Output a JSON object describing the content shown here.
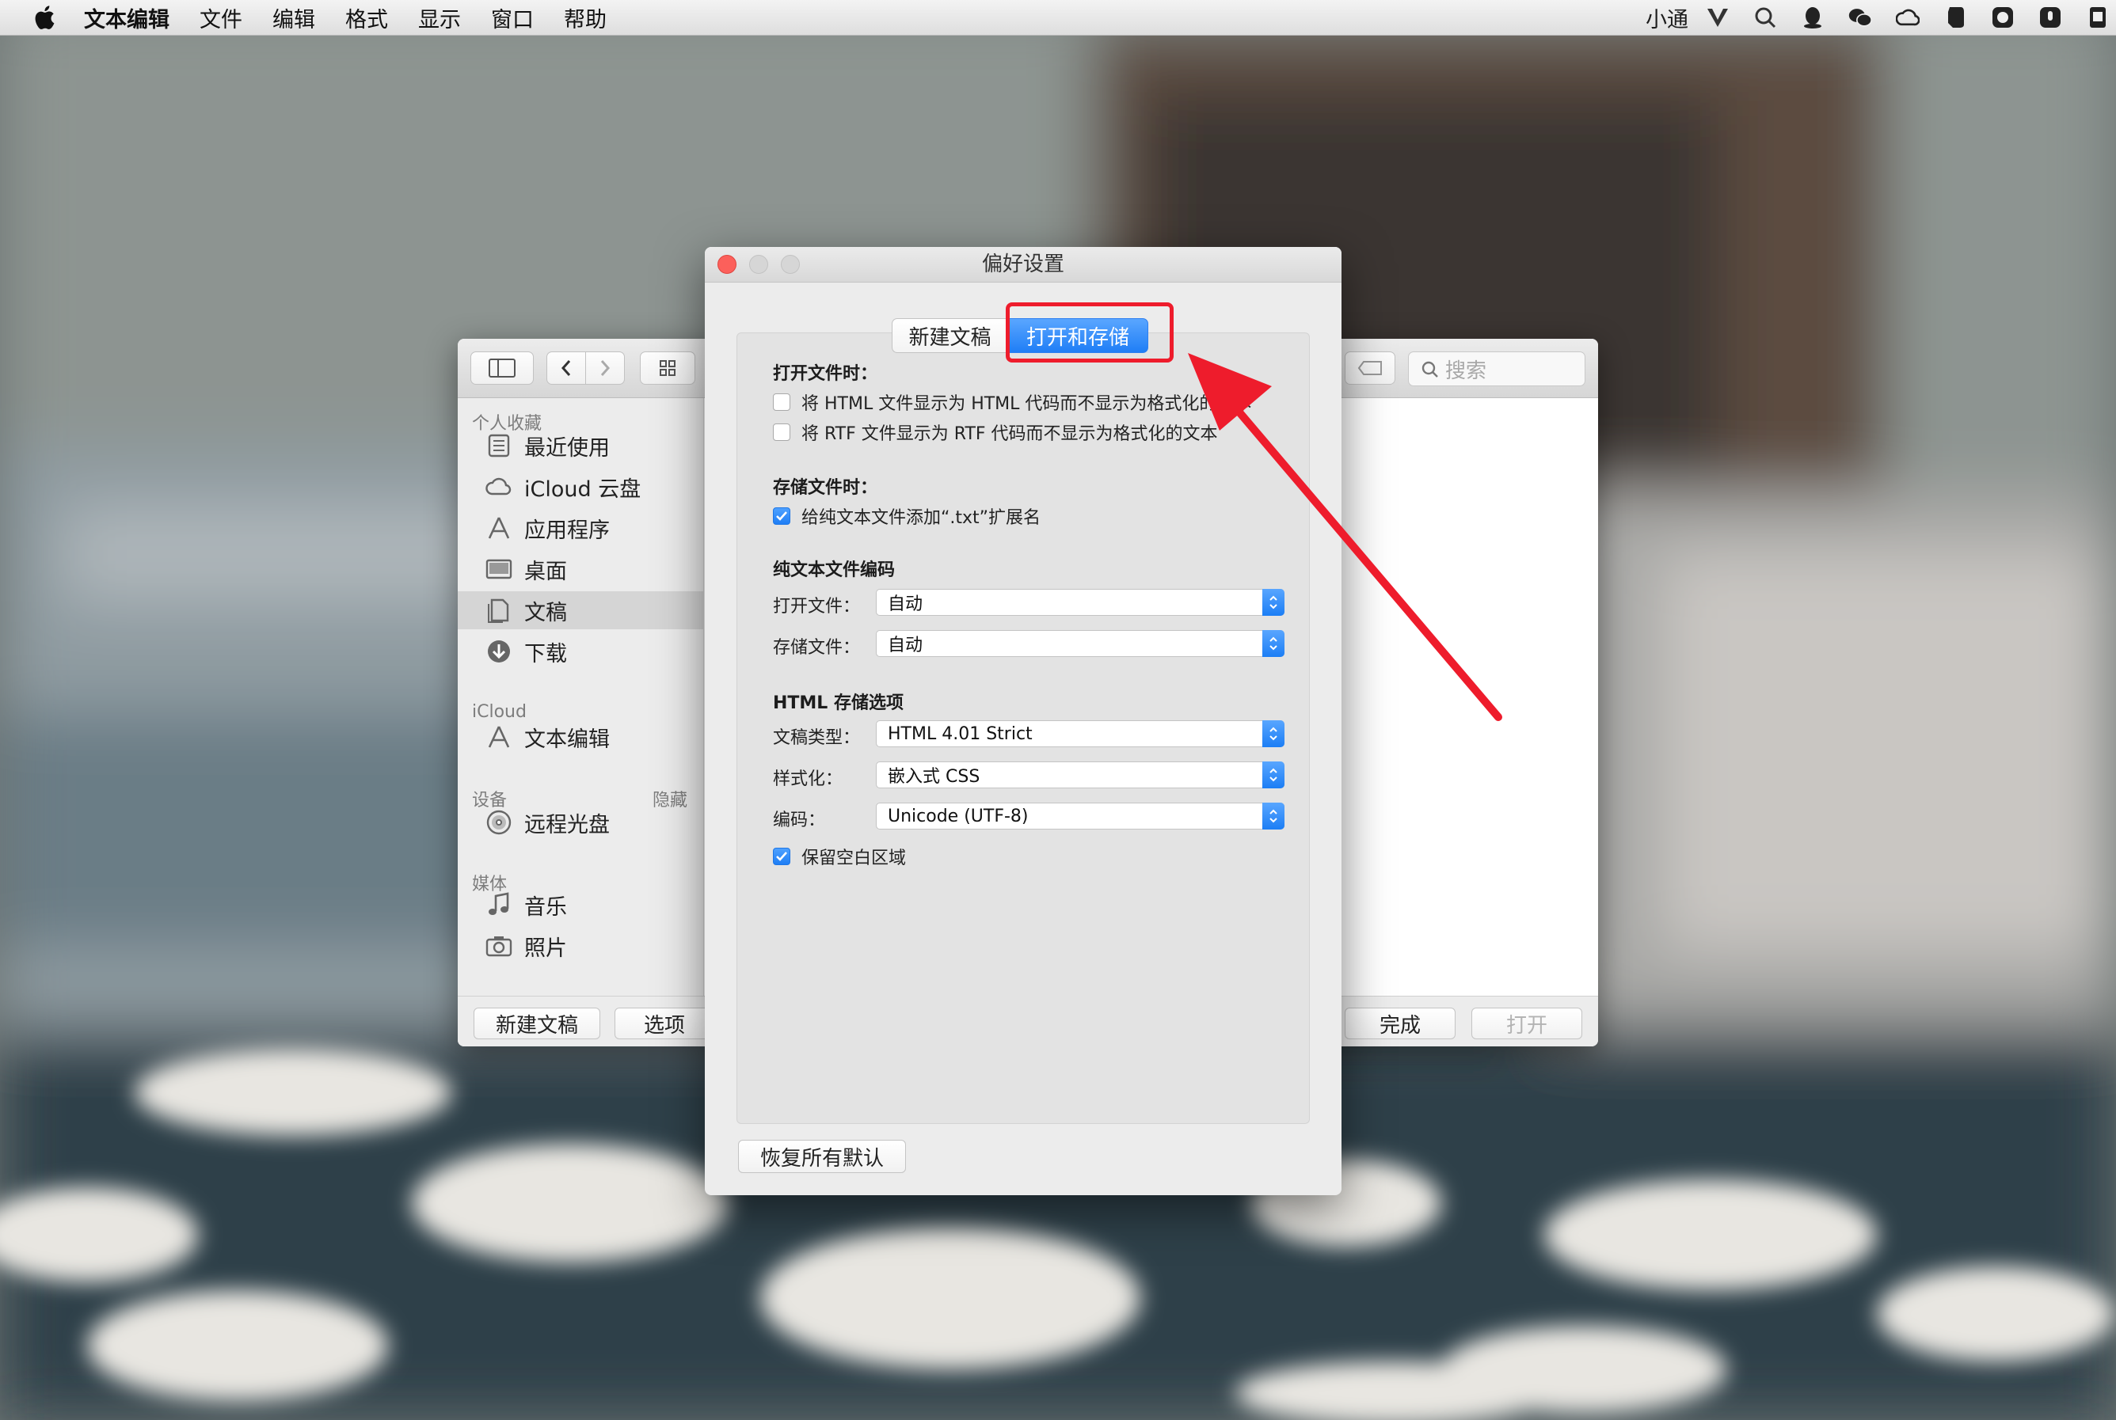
{
  "menubar": {
    "app_name": "文本编辑",
    "items": [
      "文件",
      "编辑",
      "格式",
      "显示",
      "窗口",
      "帮助"
    ],
    "user": "小通",
    "tray_icons": [
      "vpn-icon",
      "search-chat-icon",
      "qq-icon",
      "wechat-icon",
      "creative-cloud-icon",
      "evernote-icon",
      "mask-icon",
      "mic-icon",
      "battery-icon"
    ]
  },
  "finder": {
    "search_placeholder": "搜索",
    "sidebar": {
      "favorites_heading": "个人收藏",
      "favorites": [
        {
          "label": "最近使用",
          "icon": "recent-icon"
        },
        {
          "label": "iCloud 云盘",
          "icon": "cloud-icon"
        },
        {
          "label": "应用程序",
          "icon": "applications-icon"
        },
        {
          "label": "桌面",
          "icon": "desktop-icon"
        },
        {
          "label": "文稿",
          "icon": "documents-icon",
          "selected": true
        },
        {
          "label": "下载",
          "icon": "downloads-icon"
        }
      ],
      "icloud_heading": "iCloud",
      "icloud": [
        {
          "label": "文本编辑",
          "icon": "textedit-icon"
        }
      ],
      "devices_heading": "设备",
      "devices_hide": "隐藏",
      "devices": [
        {
          "label": "远程光盘",
          "icon": "disc-icon"
        }
      ],
      "media_heading": "媒体",
      "media": [
        {
          "label": "音乐",
          "icon": "music-icon"
        },
        {
          "label": "照片",
          "icon": "camera-icon"
        }
      ]
    },
    "bottom": {
      "new_doc": "新建文稿",
      "options": "选项",
      "done": "完成",
      "open": "打开"
    }
  },
  "prefs": {
    "title": "偏好设置",
    "tabs": [
      "新建文稿",
      "打开和存储"
    ],
    "active_tab": "打开和存储",
    "open_heading": "打开文件时：",
    "open_options": [
      {
        "label": "将 HTML 文件显示为 HTML 代码而不显示为格式化的文本",
        "checked": false
      },
      {
        "label": "将 RTF 文件显示为 RTF 代码而不显示为格式化的文本",
        "checked": false
      }
    ],
    "save_heading": "存储文件时：",
    "save_option": {
      "label": "给纯文本文件添加“.txt”扩展名",
      "checked": true
    },
    "encoding_heading": "纯文本文件编码",
    "open_file_label": "打开文件：",
    "open_file_value": "自动",
    "save_file_label": "存储文件：",
    "save_file_value": "自动",
    "html_heading": "HTML 存储选项",
    "doc_type_label": "文稿类型：",
    "doc_type_value": "HTML 4.01 Strict",
    "styling_label": "样式化：",
    "styling_value": "嵌入式 CSS",
    "encoding_label": "编码：",
    "encoding_value": "Unicode (UTF-8)",
    "preserve_whitespace": {
      "label": "保留空白区域",
      "checked": true
    },
    "restore_defaults": "恢复所有默认"
  },
  "colors": {
    "accent": "#1f7ef6",
    "annotation_red": "#ee1c2c",
    "close_light": "#fc605b"
  }
}
